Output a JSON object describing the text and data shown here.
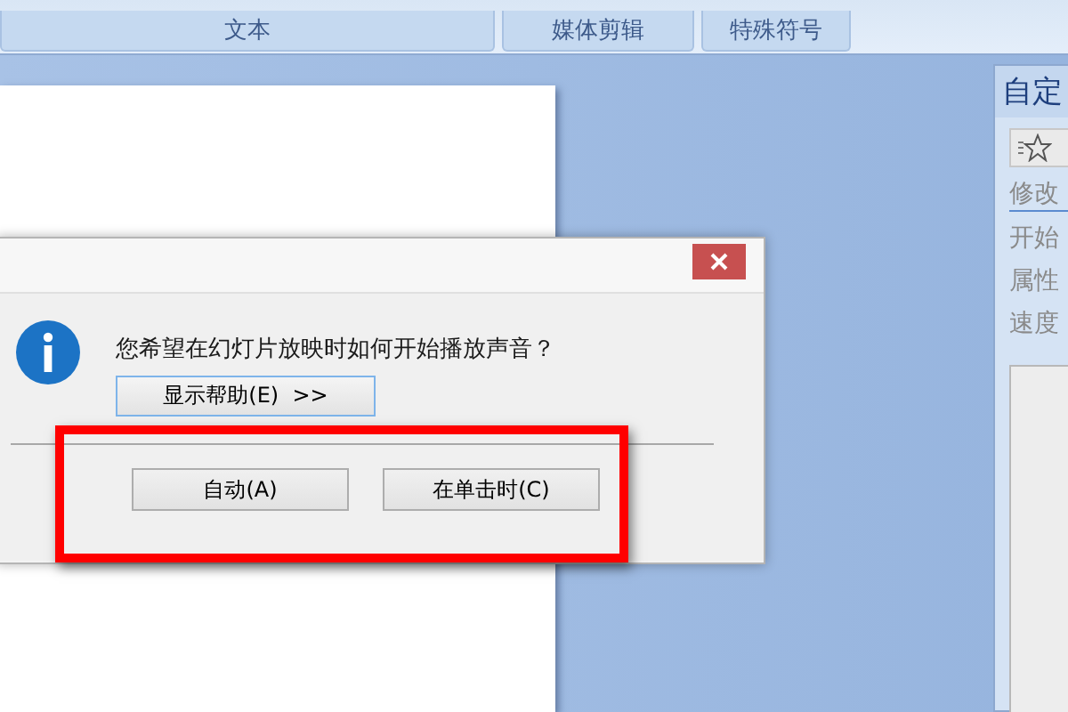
{
  "ribbon_groups": [
    {
      "label": "文本"
    },
    {
      "label": "媒体剪辑"
    },
    {
      "label": "特殊符号"
    }
  ],
  "task_pane": {
    "title": "自定",
    "items": [
      {
        "label": "修改",
        "kind": "link"
      },
      {
        "label": "开始",
        "kind": "label"
      },
      {
        "label": "属性",
        "kind": "label"
      },
      {
        "label": "速度",
        "kind": "label"
      }
    ]
  },
  "dialog": {
    "message": "您希望在幻灯片放映时如何开始播放声音？",
    "help_button": "显示帮助(E)  >>",
    "buttons": [
      "自动(A)",
      "在单击时(C)"
    ]
  }
}
